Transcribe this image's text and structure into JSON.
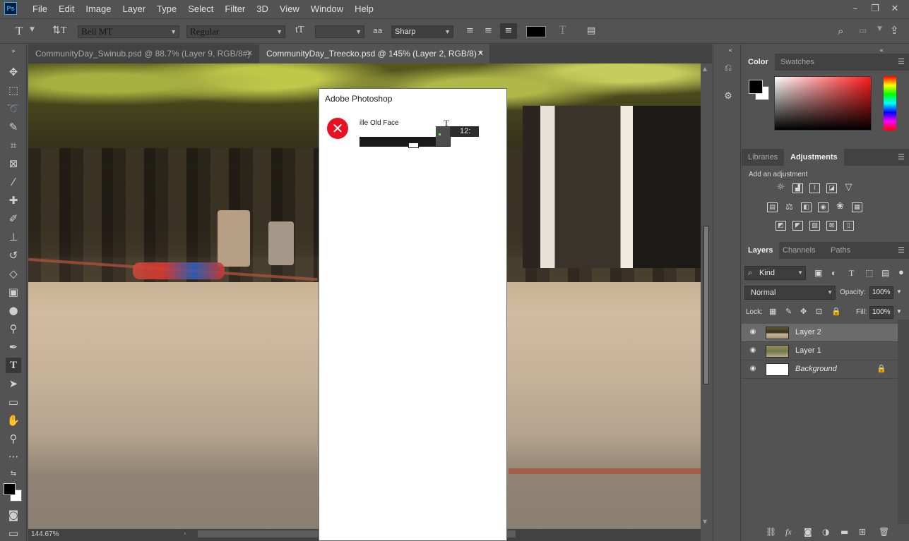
{
  "menubar": {
    "logo": "Ps",
    "items": [
      "File",
      "Edit",
      "Image",
      "Layer",
      "Type",
      "Select",
      "Filter",
      "3D",
      "View",
      "Window",
      "Help"
    ],
    "window_controls": {
      "minimize": "–",
      "restore": "❐",
      "close": "✕"
    }
  },
  "options_bar": {
    "tool_glyph": "T",
    "orientation_glyph": "⇅T",
    "font_family": "Bell MT",
    "font_style": "Regular",
    "size_glyph": "tT",
    "font_size": "",
    "aa_glyph": "aa",
    "antialias": "Sharp",
    "text_color": "#000000"
  },
  "tabs": [
    {
      "label": "CommunityDay_Swinub.psd @ 88.7% (Layer 9, RGB/8#)",
      "close": "✕"
    },
    {
      "label": "CommunityDay_Treecko.psd @ 145% (Layer 2, RGB/8) *",
      "close": "✕"
    }
  ],
  "status": {
    "zoom": "144.67%"
  },
  "dialog": {
    "title": "Adobe Photoshop",
    "icon": "✕",
    "message": "ille Old Face",
    "glitch_glyph": "T",
    "font_size_fragment": "12:"
  },
  "color_panel": {
    "tabs": [
      "Color",
      "Swatches"
    ],
    "foreground": "#000000",
    "background": "#ffffff"
  },
  "adjustments_panel": {
    "tabs": [
      "Libraries",
      "Adjustments"
    ],
    "caption": "Add an adjustment"
  },
  "layers_panel": {
    "tabs": [
      "Layers",
      "Channels",
      "Paths"
    ],
    "filter": "Kind",
    "blend_mode": "Normal",
    "opacity_label": "Opacity:",
    "opacity": "100%",
    "lock_label": "Lock:",
    "fill_label": "Fill:",
    "fill": "100%",
    "layers": [
      {
        "name": "Layer 2",
        "selected": true
      },
      {
        "name": "Layer 1",
        "selected": false
      },
      {
        "name": "Background",
        "selected": false,
        "locked": true
      }
    ]
  }
}
